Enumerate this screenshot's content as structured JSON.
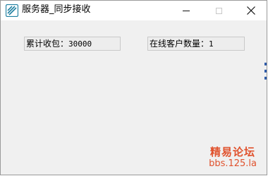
{
  "window": {
    "title": "服务器_同步接收",
    "icon": "app-icon"
  },
  "controls": {
    "minimize": "minimize-icon",
    "maximize": "maximize-icon",
    "close": "close-icon"
  },
  "fields": {
    "packets_label": "累计收包：",
    "packets_value": "30000",
    "clients_label": "在线客户数量：",
    "clients_value": "1"
  },
  "watermark": {
    "title": "精易论坛",
    "url": "bbs.125.la",
    "color": "#e0522d"
  }
}
